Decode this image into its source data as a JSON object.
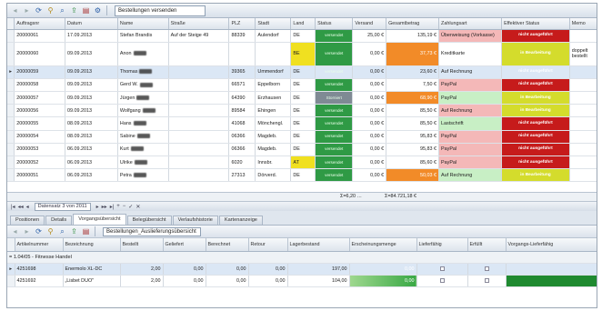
{
  "toolbar": {
    "view_select": "Bestellungen versenden"
  },
  "orders": {
    "columns": [
      "Auftragsnr",
      "Datum",
      "Name",
      "Straße",
      "PLZ",
      "Stadt",
      "Land",
      "Status",
      "Versand",
      "Gesamtbetrag",
      "Zahlungsart",
      "Effektiver Status",
      "Memo"
    ],
    "rows": [
      {
        "nr": "20000061",
        "date": "17.09.2013",
        "name": "Stefan Brandis",
        "street": "Auf der Steige 49",
        "plz": "88339",
        "city": "Aulendorf",
        "land": "DE",
        "status": "versendet",
        "versand": "25,00 €",
        "total": "135,19 €",
        "pay": "Überweisung (Vorkasse)",
        "eff": "nicht ausgeführt",
        "memo": "",
        "blur": false
      },
      {
        "nr": "20000060",
        "date": "09.09.2013",
        "name": "Anon",
        "street": "",
        "plz": "",
        "city": "",
        "land": "BE",
        "status": "versendet",
        "versand": "0,00 €",
        "total": "37,73 €",
        "pay": "Kreditkarte",
        "eff": "in Bearbeitung",
        "memo": "doppelt bestellt",
        "blur": true
      },
      {
        "nr": "20000059",
        "date": "09.09.2013",
        "name": "Thomas",
        "street": "",
        "plz": "39365",
        "city": "Ummendorf",
        "land": "DE",
        "status": "versendet",
        "versand": "0,00 €",
        "total": "23,60 €",
        "pay": "Auf Rechnung",
        "eff": "nicht ausgeführt",
        "memo": "",
        "blur": true
      },
      {
        "nr": "20000058",
        "date": "09.09.2013",
        "name": "Gerd W.",
        "street": "",
        "plz": "66571",
        "city": "Eppelborn",
        "land": "DE",
        "status": "versendet",
        "versand": "0,00 €",
        "total": "7,50 €",
        "pay": "PayPal",
        "eff": "nicht ausgeführt",
        "memo": "",
        "blur": true
      },
      {
        "nr": "20000057",
        "date": "09.09.2013",
        "name": "Jürgen",
        "street": "",
        "plz": "64390",
        "city": "Erzhausen",
        "land": "DE",
        "status": "Storniert",
        "versand": "0,00 €",
        "total": "68,90 €",
        "pay": "PayPal",
        "eff": "in Bearbeitung",
        "memo": "",
        "blur": true
      },
      {
        "nr": "20000056",
        "date": "09.09.2013",
        "name": "Wolfgang",
        "street": "",
        "plz": "89584",
        "city": "Ehingen",
        "land": "DE",
        "status": "versendet",
        "versand": "0,00 €",
        "total": "85,50 €",
        "pay": "Auf Rechnung",
        "eff": "in Bearbeitung",
        "memo": "",
        "blur": true
      },
      {
        "nr": "20000055",
        "date": "08.09.2013",
        "name": "Hans",
        "street": "",
        "plz": "41068",
        "city": "Mönchengl.",
        "land": "DE",
        "status": "versendet",
        "versand": "0,00 €",
        "total": "85,50 €",
        "pay": "Lastschrift",
        "eff": "nicht ausgeführt",
        "memo": "",
        "blur": true
      },
      {
        "nr": "20000054",
        "date": "08.09.2013",
        "name": "Sabine",
        "street": "",
        "plz": "06366",
        "city": "Magdeb.",
        "land": "DE",
        "status": "versendet",
        "versand": "0,00 €",
        "total": "95,83 €",
        "pay": "PayPal",
        "eff": "nicht ausgeführt",
        "memo": "",
        "blur": true
      },
      {
        "nr": "20000053",
        "date": "06.09.2013",
        "name": "Kurt",
        "street": "",
        "plz": "06366",
        "city": "Magdeb.",
        "land": "DE",
        "status": "versendet",
        "versand": "0,00 €",
        "total": "95,83 €",
        "pay": "PayPal",
        "eff": "nicht ausgeführt",
        "memo": "",
        "blur": true
      },
      {
        "nr": "20000052",
        "date": "06.09.2013",
        "name": "Ulrike",
        "street": "",
        "plz": "6020",
        "city": "Innsbr.",
        "land": "AT",
        "status": "versendet",
        "versand": "0,00 €",
        "total": "85,60 €",
        "pay": "PayPal",
        "eff": "nicht ausgeführt",
        "memo": "",
        "blur": true
      },
      {
        "nr": "20000051",
        "date": "06.09.2013",
        "name": "Petra",
        "street": "",
        "plz": "27313",
        "city": "Dörverd.",
        "land": "DE",
        "status": "versendet",
        "versand": "0,00 €",
        "total": "50,03 €",
        "pay": "Auf Rechnung",
        "eff": "in Bearbeitung",
        "memo": "",
        "blur": true
      }
    ],
    "sum_versand": "Σ=6,20 …",
    "sum_total": "Σ=84.721,18 €"
  },
  "navigator": {
    "record": "Datensatz 3 von 2011"
  },
  "tabs": [
    "Positionen",
    "Details",
    "Vorgangsübersicht",
    "Belegübersicht",
    "Verlaufshistorie",
    "Kartenanzeige"
  ],
  "detail_toolbar": {
    "view_select": "Bestellungen_Auslieferungsübersicht"
  },
  "positions": {
    "columns": [
      "Artikelnummer",
      "Bezeichnung",
      "Bestellt",
      "Geliefert",
      "Berechnet",
      "Retour",
      "Lagerbestand",
      "Erscheinungsmenge",
      "Lieferfähig",
      "Erfüllt",
      "Vorgangs-Lieferfähig"
    ],
    "group": "= 1.04/05 - Fitnesse Handel",
    "rows": [
      {
        "art": "4251698",
        "desc": "Enermolo XL-DC",
        "bestellt": "2,00",
        "geliefert": "0,00",
        "berechnet": "0,00",
        "retour": "0,00",
        "lager": "197,00",
        "menge": "0,00"
      },
      {
        "art": "4251692",
        "desc": "„Lisbet DUO\"",
        "bestellt": "2,00",
        "geliefert": "0,00",
        "berechnet": "0,00",
        "retour": "0,00",
        "lager": "104,00",
        "menge": "0,00"
      }
    ]
  },
  "colors": {
    "status_green": "#2f9a45",
    "red": "#c61b1b",
    "yellow": "#d4dc2c",
    "orange": "#f28b28"
  }
}
